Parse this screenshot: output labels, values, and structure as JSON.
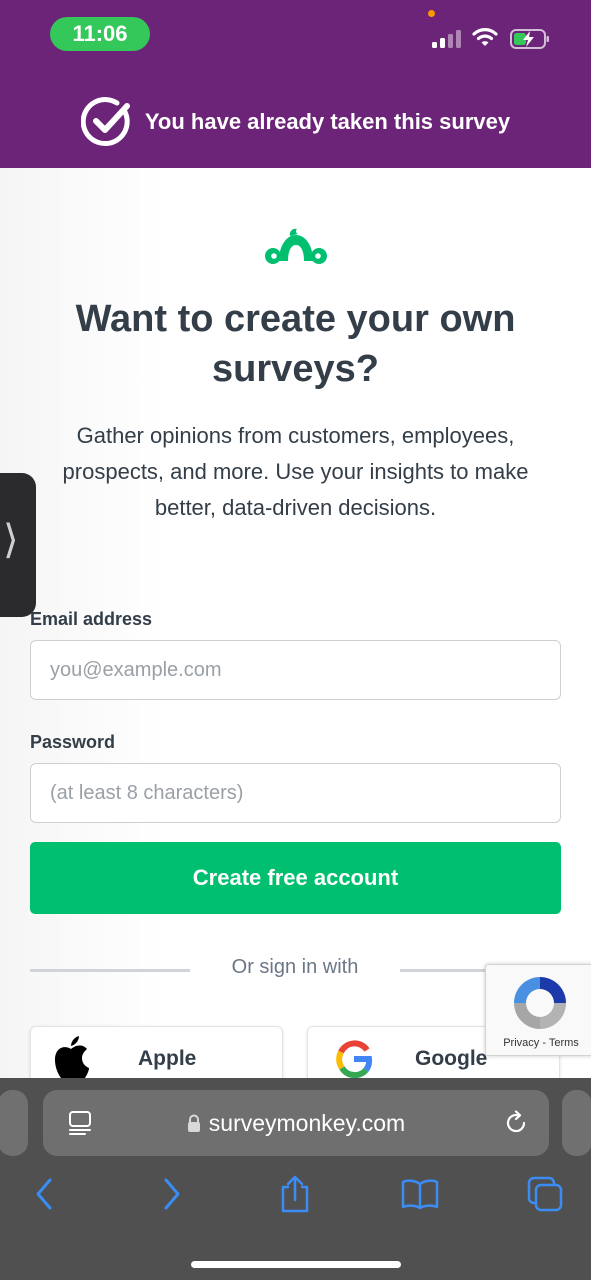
{
  "status_bar": {
    "time": "11:06"
  },
  "banner": {
    "text": "You have already taken this survey",
    "icon": "check-circle-icon"
  },
  "content": {
    "logo": "surveymonkey-logo",
    "headline": "Want to create your own surveys?",
    "subtext": "Gather opinions from customers, employees, prospects, and more. Use your insights to make better, data-driven decisions."
  },
  "form": {
    "email_label": "Email address",
    "email_placeholder": "you@example.com",
    "email_value": "",
    "password_label": "Password",
    "password_placeholder": "(at least 8 characters)",
    "password_value": "",
    "submit_label": "Create free account",
    "divider_text": "Or sign in with"
  },
  "social": {
    "apple_label": "Apple",
    "google_label": "Google"
  },
  "recaptcha": {
    "privacy": "Privacy",
    "separator": " - ",
    "terms": "Terms"
  },
  "browser": {
    "url": "surveymonkey.com"
  },
  "colors": {
    "header_purple": "#6b2478",
    "brand_green": "#00bf6f",
    "time_pill_green": "#34c759",
    "ios_blue": "#3b8df5"
  }
}
